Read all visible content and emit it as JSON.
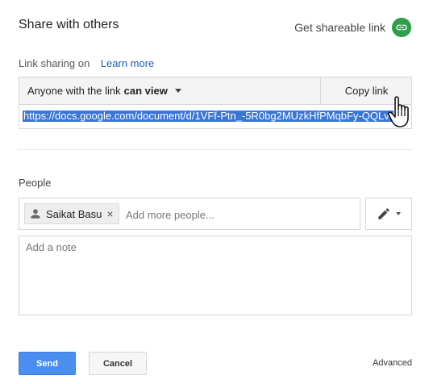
{
  "dialog": {
    "title": "Share with others",
    "get_shareable_link": "Get shareable link"
  },
  "link_sharing": {
    "status": "Link sharing on",
    "learn_more": "Learn more",
    "access_prefix": "Anyone with the link",
    "access_level": "can view",
    "copy_link": "Copy link",
    "url": "https://docs.google.com/document/d/1VFf-Ptn_-5R0bg2MUzkHfPMqbFy-QQLvr"
  },
  "people": {
    "label": "People",
    "chips": [
      {
        "name": "Saikat Basu"
      }
    ],
    "add_placeholder": "Add more people...",
    "note_placeholder": "Add a note"
  },
  "actions": {
    "send": "Send",
    "cancel": "Cancel",
    "advanced": "Advanced"
  },
  "colors": {
    "accent_blue": "#4a8ef0",
    "link_blue": "#1a5fb4",
    "link_icon_green": "#2e9e4a",
    "url_highlight": "#3a76d6"
  },
  "icons": {
    "get_link": "link-icon",
    "chip_avatar": "person-icon",
    "permission": "pencil-icon",
    "cursor": "hand-pointer-icon"
  }
}
